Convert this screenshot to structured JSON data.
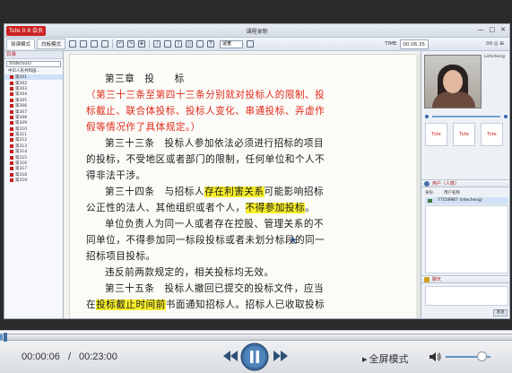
{
  "app": {
    "logo": "Tute 0.9 会员",
    "window_title": "课程录制",
    "colors": {
      "highlight": "#f7ee2a",
      "red_text": "#e02a1a",
      "accent": "#5e92c6"
    }
  },
  "toolbar": {
    "tabs": [
      {
        "label": "授课模式",
        "active": true
      },
      {
        "label": "白板模式",
        "active": false
      }
    ],
    "zoom_label": "适宽",
    "time_label": "TIME",
    "time_value": "00.06.35",
    "right_status": "00 ◎ ⊞"
  },
  "sidebar": {
    "header": "目录",
    "field": "Slide(ous)",
    "tree_root": "中华人民共和国...",
    "pages": [
      "第301",
      "第302",
      "第303",
      "第304",
      "第305",
      "第306",
      "第307",
      "第308",
      "第309",
      "第310",
      "第311",
      "第312",
      "第313",
      "第314",
      "第315",
      "第316",
      "第317",
      "第318",
      "第319"
    ],
    "selected_index": 0
  },
  "document": {
    "lines": [
      {
        "segments": [
          {
            "text": "第三章　投　　标",
            "style": "normal"
          }
        ],
        "indent": true
      },
      {
        "segments": [
          {
            "text": "（第三十三条至第四十三条分别就对投标人的限制、投",
            "style": "red"
          }
        ],
        "indent": false
      },
      {
        "segments": [
          {
            "text": "标截止、联合体投标、投标人变化、串通投标、弄虚作",
            "style": "red"
          }
        ],
        "indent": false
      },
      {
        "segments": [
          {
            "text": "假等情况作了具体规定。）",
            "style": "red"
          }
        ],
        "indent": false
      },
      {
        "segments": [
          {
            "text": "第三十三条　投标人参加依法必须进行招标的项目",
            "style": "normal"
          }
        ],
        "indent": true
      },
      {
        "segments": [
          {
            "text": "的投标，不受地区或者部门的限制，任何单位和个人不",
            "style": "normal"
          }
        ],
        "indent": false
      },
      {
        "segments": [
          {
            "text": "得非法干涉。",
            "style": "normal"
          }
        ],
        "indent": false
      },
      {
        "segments": [
          {
            "text": "第三十四条　与招标人",
            "style": "normal"
          },
          {
            "text": "存在利害关系",
            "style": "hl"
          },
          {
            "text": "可能影响招标",
            "style": "normal"
          }
        ],
        "indent": true
      },
      {
        "segments": [
          {
            "text": "公正性的法人、其他组织或者个人，",
            "style": "normal"
          },
          {
            "text": "不得参加投标",
            "style": "hl"
          },
          {
            "text": "。",
            "style": "normal"
          }
        ],
        "indent": false
      },
      {
        "segments": [
          {
            "text": "单位负责人为同一人或者存在控股、管理关系的不",
            "style": "normal"
          }
        ],
        "indent": true
      },
      {
        "segments": [
          {
            "text": "同单位，不得参加同一标段投标或者未划分标段的同一",
            "style": "normal"
          }
        ],
        "indent": false
      },
      {
        "segments": [
          {
            "text": "招标项目投标。",
            "style": "normal"
          }
        ],
        "indent": false
      },
      {
        "segments": [
          {
            "text": "违反前两款规定的，相关投标均无效。",
            "style": "normal"
          }
        ],
        "indent": true
      },
      {
        "segments": [
          {
            "text": "第三十五条　投标人撤回已提交的投标文件，应当",
            "style": "normal"
          }
        ],
        "indent": true
      },
      {
        "segments": [
          {
            "text": "在",
            "style": "normal"
          },
          {
            "text": "投标截止时间前",
            "style": "hl"
          },
          {
            "text": "书面通知招标人。招标人已收取投标",
            "style": "normal"
          }
        ],
        "indent": false
      }
    ]
  },
  "right_panel": {
    "video_name": "Lichcheng",
    "tools": [
      "Tute",
      "Tute",
      "Tute"
    ],
    "users_header": "用户（人数）",
    "user_columns": [
      "身份",
      "用户名称"
    ],
    "user_row": "77558987 (lidecheng)",
    "chat_header": "聊天",
    "send_label": "发送"
  },
  "player": {
    "current_time": "00:00:06",
    "separator": "/",
    "total_time": "00:23:00",
    "progress_fraction": 0.0043,
    "fullscreen_label": "全屏模式",
    "volume_fraction": 0.8
  }
}
